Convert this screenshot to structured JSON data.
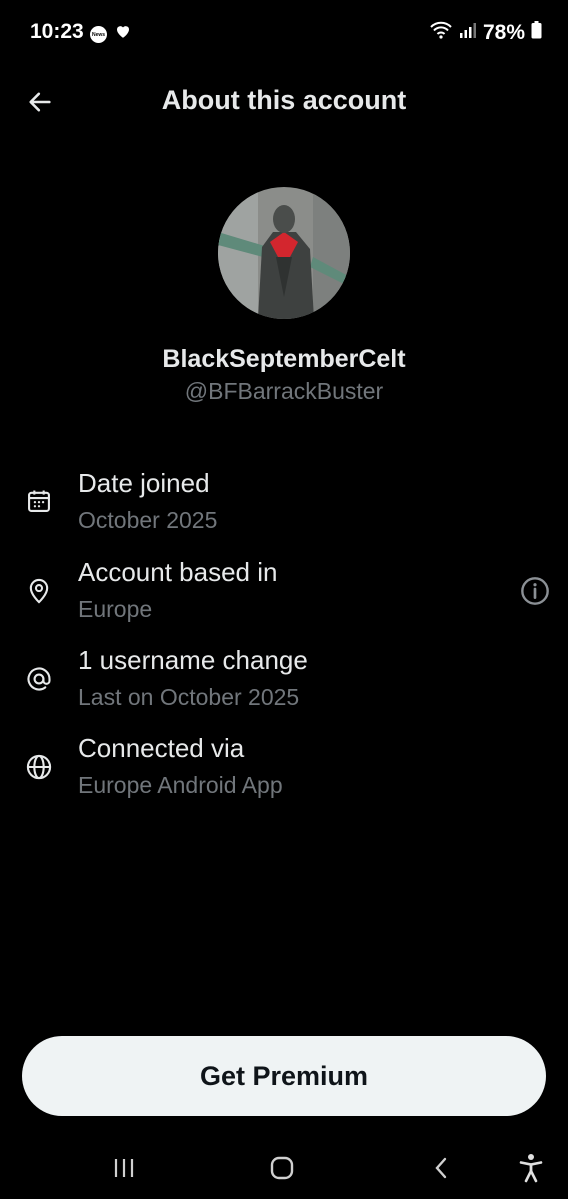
{
  "status_bar": {
    "time": "10:23",
    "news_badge": "News",
    "battery": "78%"
  },
  "header": {
    "title": "About this account"
  },
  "profile": {
    "display_name": "BlackSeptemberCelt",
    "handle": "@BFBarrackBuster"
  },
  "details": [
    {
      "icon": "calendar-icon",
      "title": "Date joined",
      "value": "October 2025"
    },
    {
      "icon": "location-pin-icon",
      "title": "Account based in",
      "value": "Europe"
    },
    {
      "icon": "at-sign-icon",
      "title": "1 username change",
      "value": "Last on October 2025"
    },
    {
      "icon": "globe-icon",
      "title": "Connected via",
      "value": "Europe Android App"
    }
  ],
  "footer": {
    "premium_label": "Get Premium"
  },
  "colors": {
    "background": "#000000",
    "primary_text": "#e7e9ea",
    "secondary_text": "#71767b",
    "button_bg": "#eff3f4",
    "button_text": "#0f1419"
  }
}
